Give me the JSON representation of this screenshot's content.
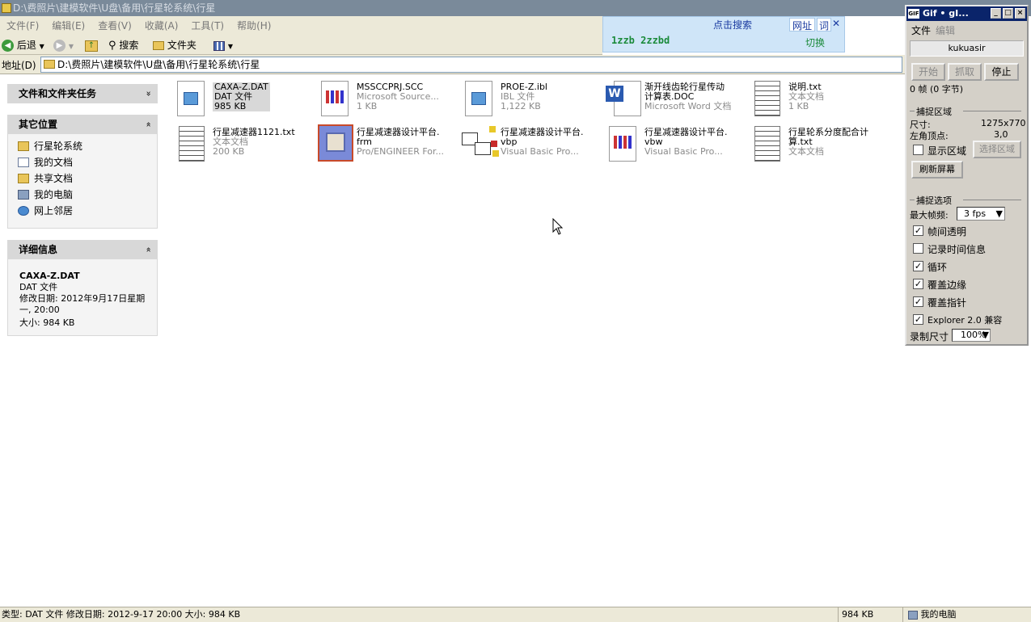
{
  "window": {
    "title": "D:\\费照片\\建模软件\\U盘\\备用\\行星轮系统\\行星"
  },
  "menu": [
    "文件(F)",
    "编辑(E)",
    "查看(V)",
    "收藏(A)",
    "工具(T)",
    "帮助(H)"
  ],
  "toolbar": {
    "back": "后退",
    "search": "搜索",
    "folders": "文件夹"
  },
  "address": {
    "label": "地址(D)",
    "value": "D:\\费照片\\建模软件\\U盘\\备用\\行星轮系统\\行星"
  },
  "search_widget": {
    "search": "点击搜索",
    "url": "网址",
    "word": "词",
    "close": "✕",
    "query": "1zzb 2zzbd",
    "switch": "切换"
  },
  "tasks": {
    "title": "文件和文件夹任务",
    "chev": "»"
  },
  "places": {
    "title": "其它位置",
    "chev": "«",
    "items": [
      "行星轮系统",
      "我的文档",
      "共享文档",
      "我的电脑",
      "网上邻居"
    ]
  },
  "details": {
    "title": "详细信息",
    "chev": "«",
    "name": "CAXA-Z.DAT",
    "type": "DAT 文件",
    "modified": "修改日期: 2012年9月17日星期一, 20:00",
    "size": "大小: 984 KB"
  },
  "files": [
    {
      "name": "CAXA-Z.DAT",
      "l2": "DAT 文件",
      "l3": "985 KB"
    },
    {
      "name": "MSSCCPRJ.SCC",
      "l2": "Microsoft Source...",
      "l3": "1 KB"
    },
    {
      "name": "PROE-Z.ibl",
      "l2": "IBL 文件",
      "l3": "1,122 KB"
    },
    {
      "name": "渐开线齿轮行星传动",
      "l2": "计算表.DOC",
      "l3": "Microsoft Word 文档"
    },
    {
      "name": "说明.txt",
      "l2": "文本文档",
      "l3": "1 KB"
    },
    {
      "name": "行星减速器1121.txt",
      "l2": "文本文档",
      "l3": "200 KB"
    },
    {
      "name": "行星减速器设计平台.",
      "l2": "frm",
      "l3": "Pro/ENGINEER For..."
    },
    {
      "name": "行星减速器设计平台.",
      "l2": "vbp",
      "l3": "Visual Basic Pro..."
    },
    {
      "name": "行星减速器设计平台.",
      "l2": "vbw",
      "l3": "Visual Basic Pro..."
    },
    {
      "name": "行星轮系分度配合计",
      "l2": "算.txt",
      "l3": "文本文档"
    }
  ],
  "statusbar": {
    "info": "类型: DAT 文件 修改日期: 2012-9-17 20:00 大小: 984 KB",
    "size": "984 KB",
    "location": "我的电脑"
  },
  "gif": {
    "title": "Gif • gI...",
    "menu_file": "文件",
    "menu_edit": "编辑",
    "user": "kukuasir",
    "start": "开始",
    "capture": "抓取",
    "stop": "停止",
    "frames": "0 帧 (0 字节)",
    "region_title": "捕捉区域",
    "size_label": "尺寸:",
    "size_value": "1275x770",
    "corner_label": "左角顶点:",
    "corner_value": "3,0",
    "show_region": "显示区域",
    "select_region": "选择区域",
    "refresh": "刷新屏幕",
    "options_title": "捕捉选项",
    "max_fps_label": "最大帧频:",
    "max_fps_value": "3 fps",
    "opt1": "帧间透明",
    "opt2": "记录时间信息",
    "opt3": "循环",
    "opt4": "覆盖边缘",
    "opt5": "覆盖指针",
    "opt6": "Explorer 2.0 兼容",
    "record_size_label": "录制尺寸",
    "record_size_value": "100%"
  }
}
